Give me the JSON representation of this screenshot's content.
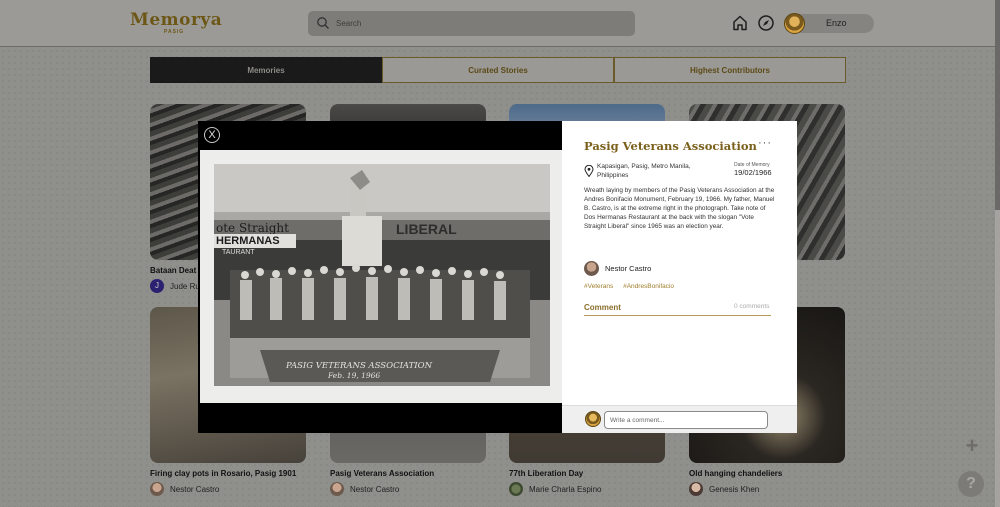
{
  "app": {
    "logo": "Memorya",
    "logo_sub": "PASIG",
    "search_placeholder": "Search",
    "user_name": "Enzo"
  },
  "tabs": [
    {
      "label": "Memories",
      "active": true
    },
    {
      "label": "Curated Stories",
      "active": false
    },
    {
      "label": "Highest Contributors",
      "active": false
    }
  ],
  "cards": [
    {
      "title": "Bataan Deat",
      "author": "Jude Ru",
      "avatar_letter": "J"
    },
    {
      "title": "Firing clay pots in Rosario, Pasig 1901",
      "author": "Nestor Castro"
    },
    {
      "title": "Pasig Veterans Association",
      "author": "Nestor Castro"
    },
    {
      "title": "77th Liberation Day",
      "author": "Marie Charla Espino"
    },
    {
      "title": "Old hanging chandeliers",
      "author": "Genesis Khen"
    }
  ],
  "modal": {
    "title": "Pasig Veterans Association",
    "more": "···",
    "location": "Kapasigan, Pasig, Metro Manila, Philippines",
    "date_label": "Date of Memory",
    "date": "19/02/1966",
    "description": "Wreath laying by members of the Pasig Veterans Association at the Andres Bonifacio Monument, February 19, 1966. My father, Manuel B. Castro, is at the extreme right in the photograph. Take note of Dos Hermanas Restaurant at the back with the slogan \"Vote Straight Liberal\" since 1965 was an election year.",
    "author": "Nestor Castro",
    "tags": [
      "#Veterans",
      "#AndresBonifacio"
    ],
    "comment_label": "Comment",
    "comment_count": "0 comments",
    "comment_placeholder": "Write a comment...",
    "close": "X"
  },
  "photo_text": {
    "banner_left": "ote Straight",
    "banner_right": "LIBERAL",
    "restaurant": "HERMANAS",
    "restaurant_sub": "TAURANT",
    "caption": "PASIG VETERANS ASSOCIATION",
    "caption_date": "Feb. 19, 1966"
  },
  "fab": {
    "add": "+",
    "help": "?"
  }
}
